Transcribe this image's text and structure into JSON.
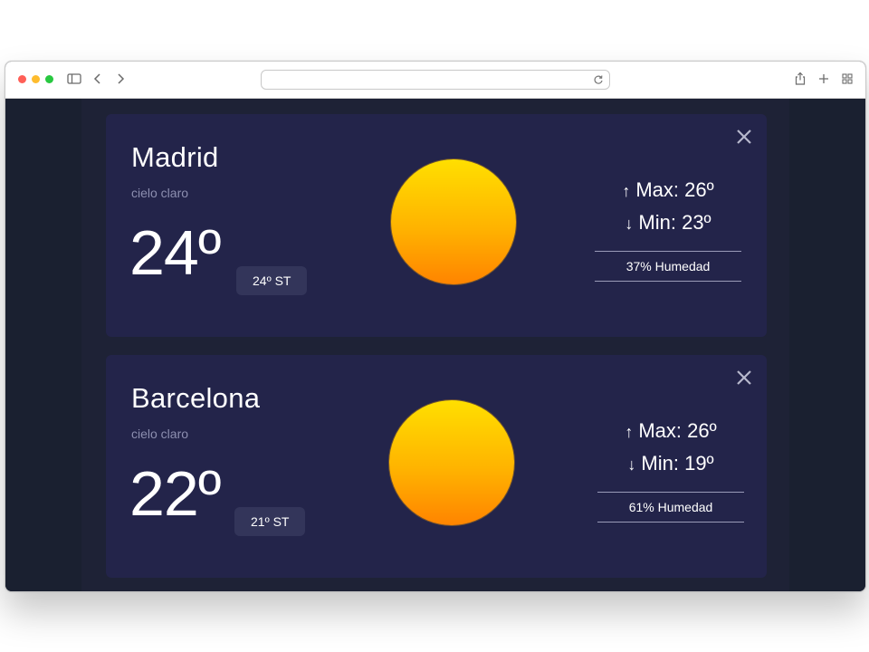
{
  "browser": {
    "address_value": ""
  },
  "cities": [
    {
      "name": "Madrid",
      "description": "cielo claro",
      "temperature": "24º",
      "feels_like": "24º ST",
      "max": "Max: 26º",
      "min": "Min: 23º",
      "humidity": "37% Humedad",
      "icon": "sun-icon"
    },
    {
      "name": "Barcelona",
      "description": "cielo claro",
      "temperature": "22º",
      "feels_like": "21º ST",
      "max": "Max: 26º",
      "min": "Min: 19º",
      "humidity": "61% Humedad",
      "icon": "sun-icon"
    }
  ],
  "colors": {
    "background": "#1a2030",
    "card": "#23244a",
    "sun_top": "#ffdf00",
    "sun_bottom": "#ff8400"
  }
}
